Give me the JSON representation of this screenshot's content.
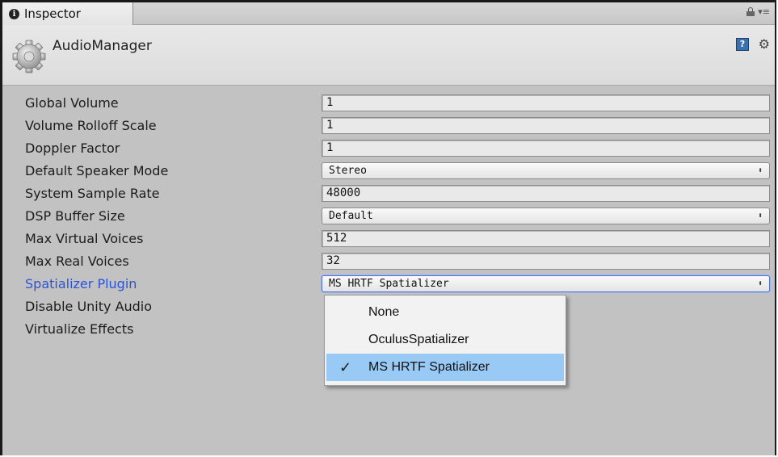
{
  "tab": {
    "title": "Inspector"
  },
  "header": {
    "title": "AudioManager"
  },
  "properties": [
    {
      "label": "Global Volume",
      "type": "field",
      "value": "1"
    },
    {
      "label": "Volume Rolloff Scale",
      "type": "field",
      "value": "1"
    },
    {
      "label": "Doppler Factor",
      "type": "field",
      "value": "1"
    },
    {
      "label": "Default Speaker Mode",
      "type": "dropdown",
      "value": "Stereo"
    },
    {
      "label": "System Sample Rate",
      "type": "field",
      "value": "48000"
    },
    {
      "label": "DSP Buffer Size",
      "type": "dropdown",
      "value": "Default"
    },
    {
      "label": "Max Virtual Voices",
      "type": "field",
      "value": "512"
    },
    {
      "label": "Max Real Voices",
      "type": "field",
      "value": "32"
    },
    {
      "label": "Spatializer Plugin",
      "type": "dropdown",
      "value": "MS HRTF Spatializer"
    },
    {
      "label": "Disable Unity Audio",
      "type": "none"
    },
    {
      "label": "Virtualize Effects",
      "type": "none"
    }
  ],
  "popup": {
    "items": [
      "None",
      "OculusSpatializer",
      "MS HRTF Spatializer"
    ],
    "selected": "MS HRTF Spatializer"
  },
  "colors": {
    "highlight_label": "#2a54d6",
    "selected_item": "#99c9f5"
  },
  "icons": [
    "info-icon",
    "lock-icon",
    "menu-icon",
    "gear-icon",
    "help-icon",
    "settings-icon",
    "checkmark-icon",
    "dropdown-arrow-icon"
  ]
}
